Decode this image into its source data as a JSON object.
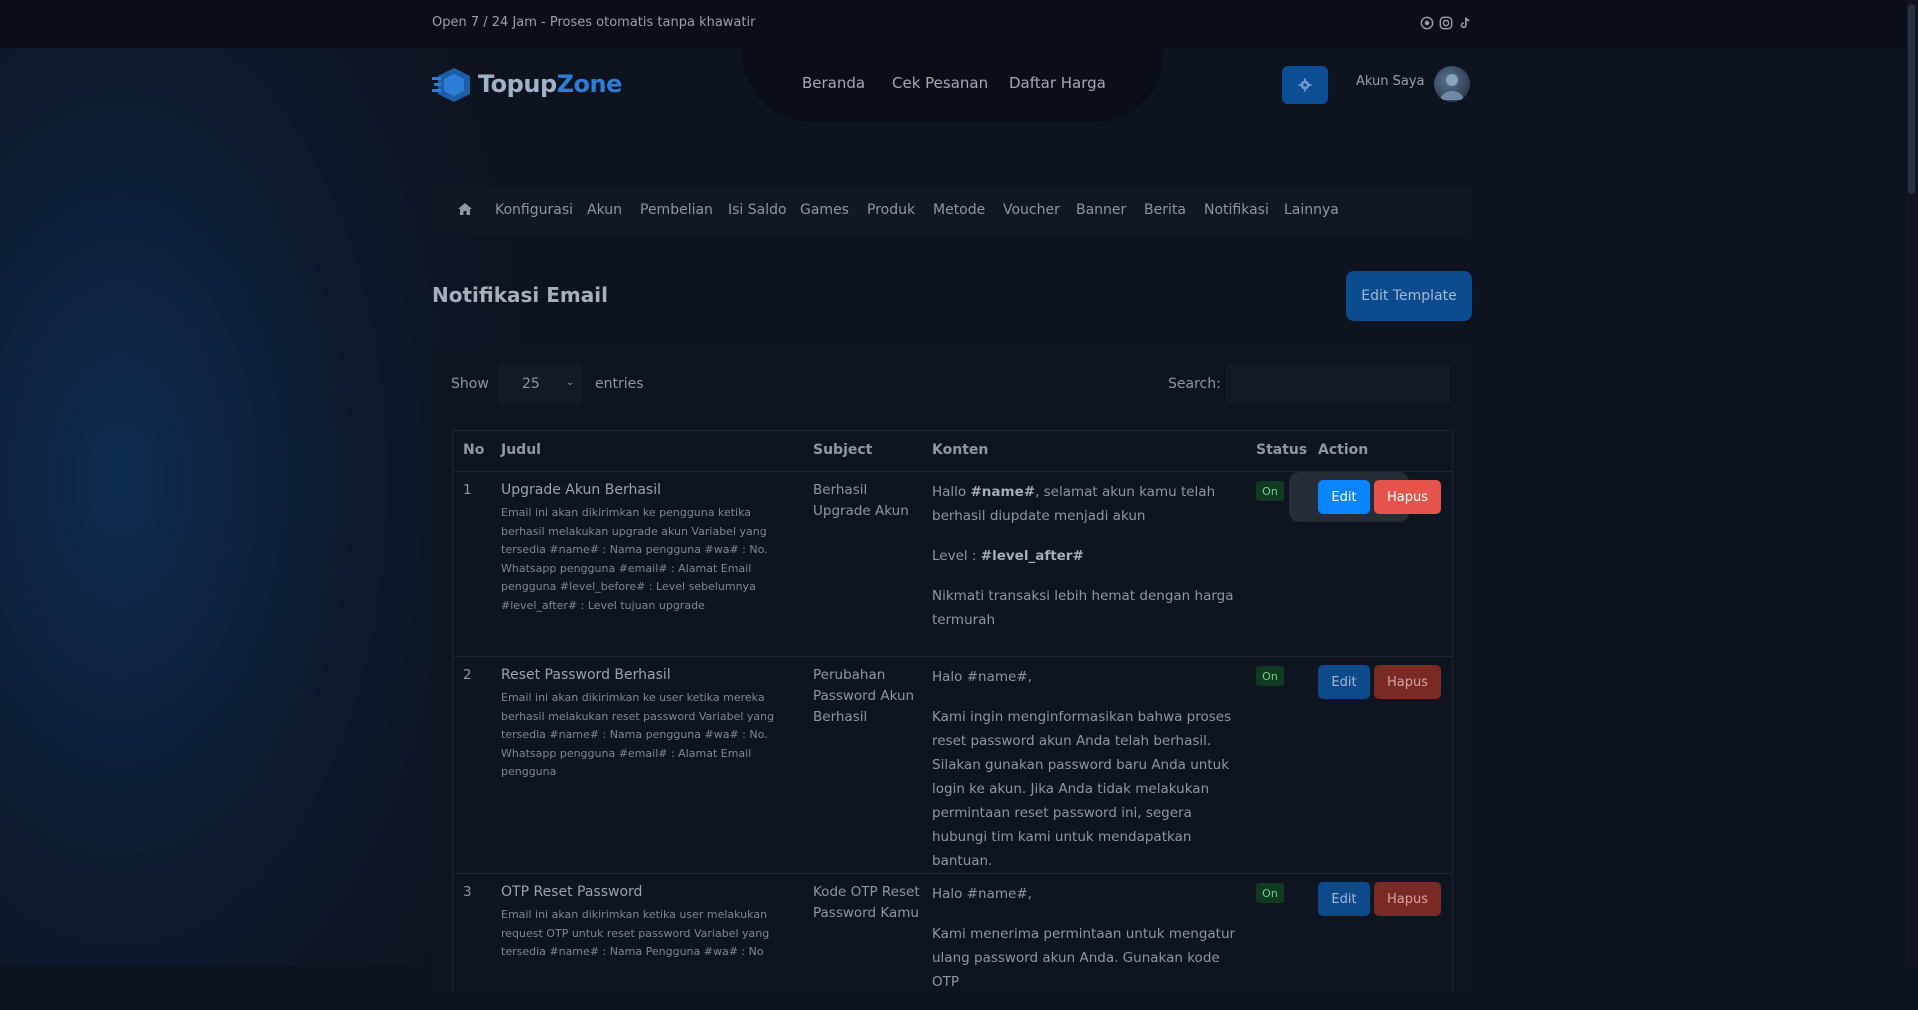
{
  "topbar": {
    "text": "Open 7 / 24 Jam - Proses otomatis tanpa khawatir",
    "icons": [
      "whatsapp-icon",
      "instagram-icon",
      "tiktok-icon"
    ]
  },
  "header": {
    "logo": {
      "part1": "Topup",
      "part2": "Zone"
    },
    "nav": [
      "Beranda",
      "Cek Pesanan",
      "Daftar Harga"
    ],
    "account_label": "Akun Saya"
  },
  "admin_menu": [
    "Konfigurasi",
    "Akun",
    "Pembelian",
    "Isi Saldo",
    "Games",
    "Produk",
    "Metode",
    "Voucher",
    "Banner",
    "Berita",
    "Notifikasi",
    "Lainnya"
  ],
  "page": {
    "title": "Notifikasi Email",
    "edit_template_label": "Edit Template"
  },
  "table_controls": {
    "show_label": "Show",
    "entries_value": "25",
    "entries_label": "entries",
    "search_label": "Search:",
    "search_value": ""
  },
  "table": {
    "headers": [
      "No",
      "Judul",
      "Subject",
      "Konten",
      "Status",
      "Action"
    ],
    "rows": [
      {
        "no": "1",
        "title": "Upgrade Akun Berhasil",
        "desc": "Email ini akan dikirimkan ke pengguna ketika berhasil melakukan upgrade akun Variabel yang tersedia #name# : Nama pengguna #wa# : No. Whatsapp pengguna #email# : Alamat Email pengguna #level_before# : Level sebelumnya #level_after# : Level tujuan upgrade",
        "subject": "Berhasil Upgrade Akun",
        "content_p1_pre": "Hallo ",
        "content_p1_bold": "#name#",
        "content_p1_post": ", selamat akun kamu telah berhasil diupdate menjadi akun",
        "content_p2_pre": "Level : ",
        "content_p2_bold": "#level_after#",
        "content_p3": "Nikmati transaksi lebih hemat dengan harga termurah",
        "status": "On",
        "edit_label": "Edit",
        "delete_label": "Hapus"
      },
      {
        "no": "2",
        "title": "Reset Password Berhasil",
        "desc": "Email ini akan dikirimkan ke user ketika mereka berhasil melakukan reset password Variabel yang tersedia #name# : Nama pengguna #wa# : No. Whatsapp pengguna #email# : Alamat Email pengguna",
        "subject": "Perubahan Password Akun Berhasil",
        "content_p1": "Halo #name#,",
        "content_p2": "Kami ingin menginformasikan bahwa proses reset password akun Anda telah berhasil. Silakan gunakan password baru Anda untuk login ke akun. Jika Anda tidak melakukan permintaan reset password ini, segera hubungi tim kami untuk mendapatkan bantuan.",
        "status": "On",
        "edit_label": "Edit",
        "delete_label": "Hapus"
      },
      {
        "no": "3",
        "title": "OTP Reset Password",
        "desc": "Email ini akan dikirimkan ketika user melakukan request OTP untuk reset password Variabel yang tersedia #name# : Nama Pengguna #wa# : No",
        "subject": "Kode OTP Reset Password Kamu",
        "content_p1": "Halo #name#,",
        "content_p2": "Kami menerima permintaan untuk mengatur ulang password akun Anda. Gunakan kode OTP",
        "status": "On",
        "edit_label": "Edit",
        "delete_label": "Hapus"
      }
    ]
  }
}
